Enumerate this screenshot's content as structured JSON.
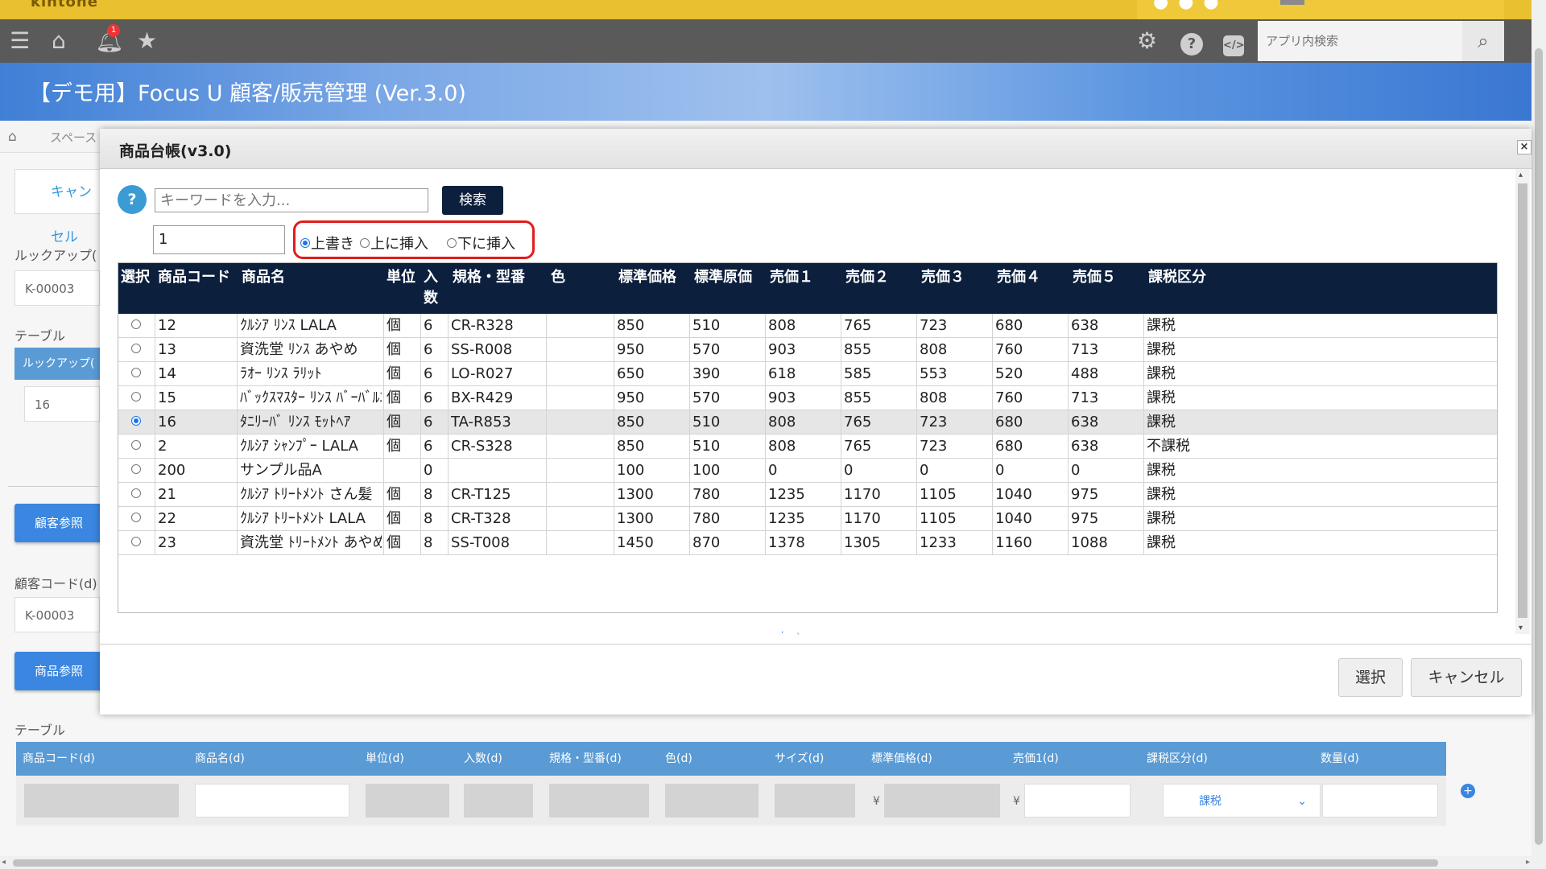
{
  "topbar": {
    "logo": "kintone"
  },
  "header": {
    "notification_count": "1",
    "app_search_placeholder": "アプリ内検索"
  },
  "banner": {
    "title": "【デモ用】Focus U 顧客/販売管理 (Ver.3.0)"
  },
  "background": {
    "breadcrumb": "スペース",
    "cancel_label": "キャンセル",
    "lookup_label": "ルックアップ(",
    "lookup_value": "K-00003",
    "table_label": "テーブル",
    "table_lookup_header": "ルックアップ(",
    "table_lookup_value": "16",
    "customer_ref_btn": "顧客参照",
    "customer_code_label": "顧客コード(d)",
    "customer_code_value": "K-00003",
    "product_ref_btn": "商品参照",
    "table2_label": "テーブル",
    "sub_headers": [
      "商品コード(d)",
      "商品名(d)",
      "単位(d)",
      "入数(d)",
      "規格・型番(d)",
      "色(d)",
      "サイズ(d)",
      "標準価格(d)",
      "売価1(d)",
      "課税区分(d)",
      "数量(d)"
    ],
    "yen": "¥",
    "tax_select_value": "課税"
  },
  "modal": {
    "title": "商品台帳(v3.0)",
    "help": "?",
    "keyword_placeholder": "キーワードを入力...",
    "search_label": "検索",
    "position_value": "1",
    "radio_options": [
      {
        "label": "上書き",
        "checked": true
      },
      {
        "label": "上に挿入",
        "checked": false
      },
      {
        "label": "下に挿入",
        "checked": false
      }
    ],
    "columns": [
      "選択",
      "商品コード",
      "商品名",
      "単位",
      "入数",
      "規格・型番",
      "色",
      "標準価格",
      "標準原価",
      "売価１",
      "売価２",
      "売価３",
      "売価４",
      "売価５",
      "課税区分"
    ],
    "rows": [
      {
        "selected": false,
        "cells": [
          "12",
          "ｸﾙｼｱ ﾘﾝｽ LALA",
          "個",
          "6",
          "CR-R328",
          "",
          "850",
          "510",
          "808",
          "765",
          "723",
          "680",
          "638",
          "課税"
        ]
      },
      {
        "selected": false,
        "cells": [
          "13",
          "資洗堂 ﾘﾝｽ あやめ",
          "個",
          "6",
          "SS-R008",
          "",
          "950",
          "570",
          "903",
          "855",
          "808",
          "760",
          "713",
          "課税"
        ]
      },
      {
        "selected": false,
        "cells": [
          "14",
          "ﾗｵｰ ﾘﾝｽ ﾗﾘｯﾄ",
          "個",
          "6",
          "LO-R027",
          "",
          "650",
          "390",
          "618",
          "585",
          "553",
          "520",
          "488",
          "課税"
        ]
      },
      {
        "selected": false,
        "cells": [
          "15",
          "ﾊﾞｯｸｽﾏｽﾀｰ ﾘﾝｽ ﾊﾞｰﾊﾞﾙｴ...",
          "個",
          "6",
          "BX-R429",
          "",
          "950",
          "570",
          "903",
          "855",
          "808",
          "760",
          "713",
          "課税"
        ]
      },
      {
        "selected": true,
        "cells": [
          "16",
          "ﾀﾆﾘｰﾊﾞ ﾘﾝｽ ﾓｯﾄﾍｱ",
          "個",
          "6",
          "TA-R853",
          "",
          "850",
          "510",
          "808",
          "765",
          "723",
          "680",
          "638",
          "課税"
        ]
      },
      {
        "selected": false,
        "cells": [
          "2",
          "ｸﾙｼｱ ｼｬﾝﾌﾟｰ LALA",
          "個",
          "6",
          "CR-S328",
          "",
          "850",
          "510",
          "808",
          "765",
          "723",
          "680",
          "638",
          "不課税"
        ]
      },
      {
        "selected": false,
        "cells": [
          "200",
          "サンプル品A",
          "",
          "0",
          "",
          "",
          "100",
          "100",
          "0",
          "0",
          "0",
          "0",
          "0",
          "課税"
        ]
      },
      {
        "selected": false,
        "cells": [
          "21",
          "ｸﾙｼｱ ﾄﾘｰﾄﾒﾝﾄ さん髪",
          "個",
          "8",
          "CR-T125",
          "",
          "1300",
          "780",
          "1235",
          "1170",
          "1105",
          "1040",
          "975",
          "課税"
        ]
      },
      {
        "selected": false,
        "cells": [
          "22",
          "ｸﾙｼｱ ﾄﾘｰﾄﾒﾝﾄ LALA",
          "個",
          "8",
          "CR-T328",
          "",
          "1300",
          "780",
          "1235",
          "1170",
          "1105",
          "1040",
          "975",
          "課税"
        ]
      },
      {
        "selected": false,
        "cells": [
          "23",
          "資洗堂 ﾄﾘｰﾄﾒﾝﾄ あやめ",
          "個",
          "8",
          "SS-T008",
          "",
          "1450",
          "870",
          "1378",
          "1305",
          "1233",
          "1160",
          "1088",
          "課税"
        ]
      }
    ],
    "select_btn": "選択",
    "cancel_btn": "キャンセル"
  },
  "colors": {
    "accent": "#3a86e0",
    "table_header": "#0c1f3d",
    "highlight": "#e31c1c",
    "topbar": "#e9c02f"
  }
}
